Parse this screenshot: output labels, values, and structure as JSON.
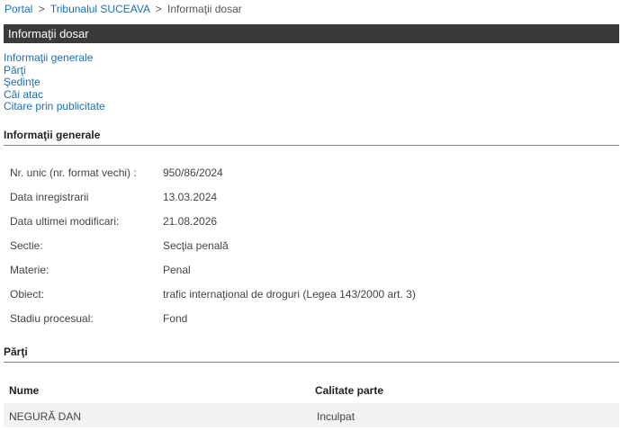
{
  "breadcrumb": {
    "items": [
      "Portal",
      "Tribunalul SUCEAVA"
    ],
    "current": "Informaţii dosar",
    "separator": ">"
  },
  "title": "Informaţii dosar",
  "nav": {
    "links": [
      "Informaţii generale",
      "Părţi",
      "Şedinţe",
      "Căi atac",
      "Citare prin publicitate"
    ]
  },
  "general": {
    "heading": "Informaţii generale",
    "rows": [
      {
        "label": "Nr. unic (nr. format vechi) :",
        "value": "950/86/2024"
      },
      {
        "label": "Data inregistrarii",
        "value": "13.03.2024"
      },
      {
        "label": "Data ultimei modificari:",
        "value": "21.08.2026"
      },
      {
        "label": "Sectie:",
        "value": "Secţia penală"
      },
      {
        "label": "Materie:",
        "value": "Penal"
      },
      {
        "label": "Obiect:",
        "value": "trafic internaţional de droguri (Legea 143/2000 art. 3)"
      },
      {
        "label": "Stadiu procesual:",
        "value": "Fond"
      }
    ]
  },
  "parties": {
    "heading": "Părţi",
    "columns": [
      "Nume",
      "Calitate parte"
    ],
    "rows": [
      {
        "name": "NEGURĂ DAN",
        "role": "Inculpat"
      }
    ]
  }
}
